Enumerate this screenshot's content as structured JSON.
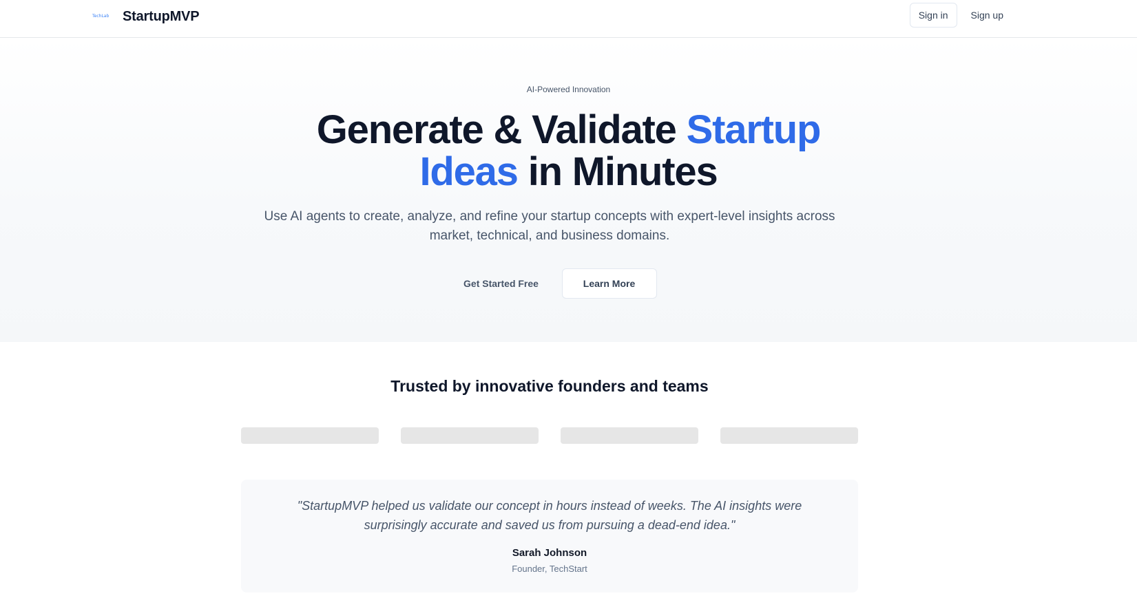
{
  "header": {
    "logo_alt": "TechLabs",
    "brand": "StartupMVP",
    "signin_label": "Sign in",
    "signup_label": "Sign up"
  },
  "hero": {
    "eyebrow": "AI-Powered Innovation",
    "title_part1": "Generate & Validate ",
    "title_accent1": "Startup",
    "title_accent2": "Ideas",
    "title_part2": " in Minutes",
    "subtitle": "Use AI agents to create, analyze, and refine your startup concepts with expert-level insights across market, technical, and business domains.",
    "primary_cta": "Get Started Free",
    "secondary_cta": "Learn More"
  },
  "trusted": {
    "title": "Trusted by innovative founders and teams",
    "logo_count": 4
  },
  "testimonial": {
    "quote": "\"StartupMVP helped us validate our concept in hours instead of weeks. The AI insights were surprisingly accurate and saved us from pursuing a dead-end idea.\"",
    "author": "Sarah Johnson",
    "role": "Founder, TechStart"
  },
  "colors": {
    "accent": "#2f6be8",
    "heading": "#0f172a",
    "muted": "#475569",
    "placeholder": "#e6e6e6"
  }
}
